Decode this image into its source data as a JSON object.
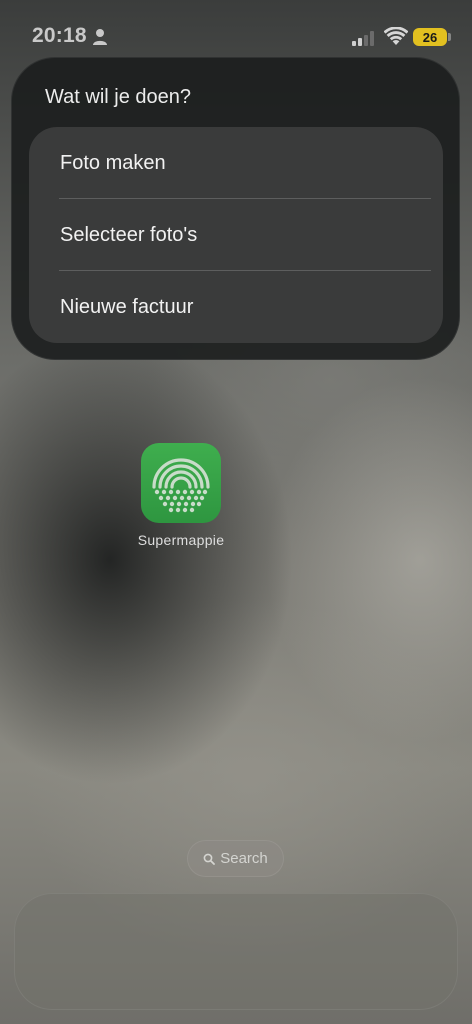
{
  "status_bar": {
    "time": "20:18",
    "battery_level": "26",
    "battery_color": "#e2c020",
    "icons": [
      "person-icon",
      "signal-icon",
      "wifi-icon",
      "battery-icon"
    ]
  },
  "menu": {
    "title": "Wat wil je doen?",
    "items": [
      {
        "label": "Foto maken"
      },
      {
        "label": "Selecteer foto's"
      },
      {
        "label": "Nieuwe factuur"
      }
    ]
  },
  "app": {
    "label": "Supermappie",
    "icon": "supermappie-app-icon",
    "icon_color": "#3aa84a"
  },
  "search": {
    "label": "Search",
    "icon": "search-icon"
  }
}
